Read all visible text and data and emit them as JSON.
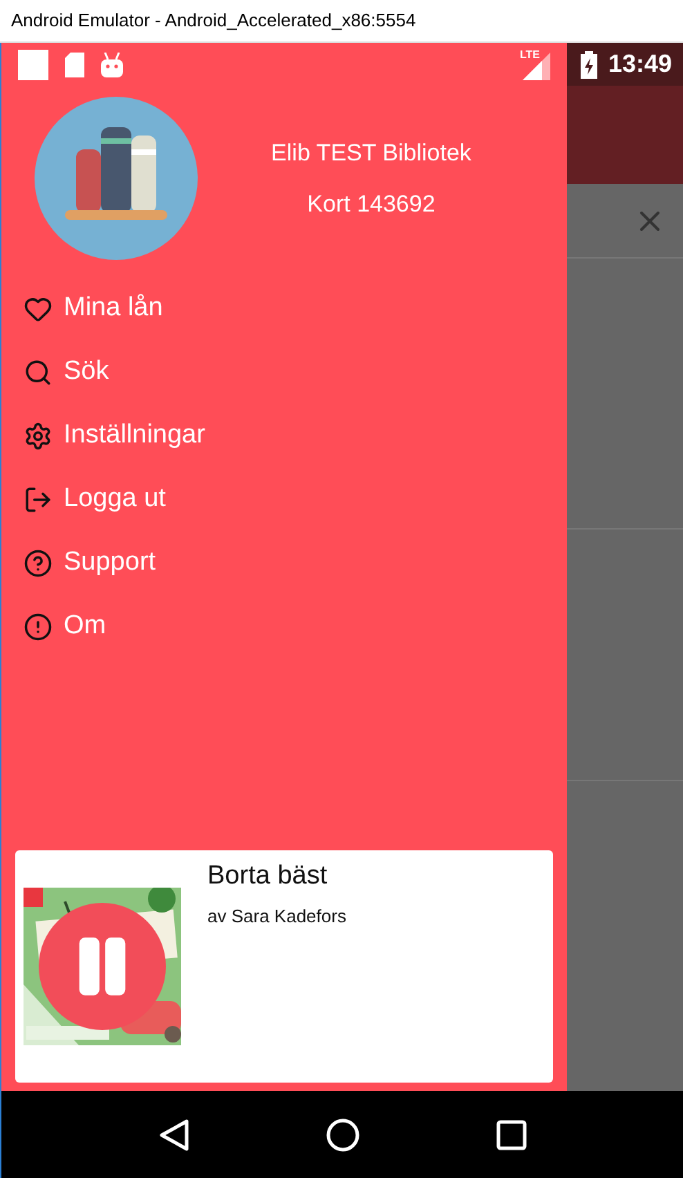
{
  "window": {
    "title": "Android Emulator - Android_Accelerated_x86:5554"
  },
  "status_bar": {
    "time": "13:49",
    "network": "LTE"
  },
  "drawer": {
    "library": "Elib TEST Bibliotek",
    "card": "Kort 143692",
    "items": [
      {
        "kind": "heart",
        "label": "Mina lån"
      },
      {
        "kind": "search",
        "label": "Sök"
      },
      {
        "kind": "settings",
        "label": "Inställningar"
      },
      {
        "kind": "logout",
        "label": "Logga ut"
      },
      {
        "kind": "help",
        "label": "Support"
      },
      {
        "kind": "info",
        "label": "Om"
      }
    ]
  },
  "player": {
    "title": "Borta bäst",
    "author": "av Sara Kadefors",
    "playing": true
  }
}
